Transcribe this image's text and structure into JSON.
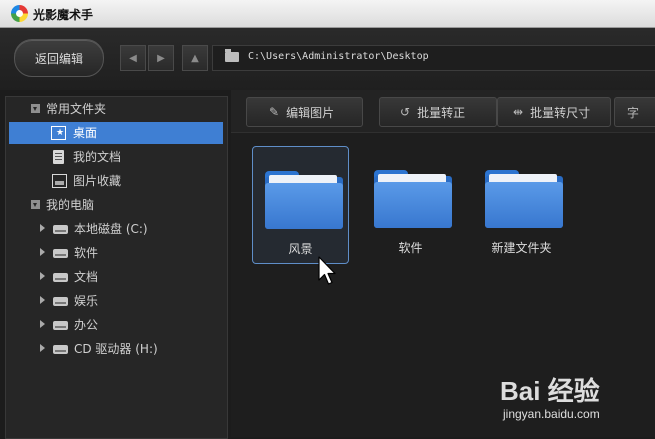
{
  "window": {
    "title": "光影魔术手",
    "logo": "app-logo-icon"
  },
  "toolbar": {
    "back_label": "返回编辑",
    "nav": {
      "back": "◀",
      "forward": "▶",
      "up": "▲"
    },
    "path": "C:\\Users\\Administrator\\Desktop"
  },
  "sidebar": {
    "groups": [
      {
        "label": "常用文件夹",
        "items": [
          "桌面",
          "我的文档",
          "图片收藏"
        ]
      },
      {
        "label": "我的电脑",
        "items": [
          "本地磁盘 (C:)",
          "软件",
          "文档",
          "娱乐",
          "办公",
          "CD 驱动器 (H:)"
        ]
      }
    ],
    "selected": "桌面"
  },
  "content_toolbar": {
    "edit_icon": "✎",
    "edit": "编辑图片",
    "rotate_icon": "↺",
    "batch_rotate": "批量转正",
    "resize_icon": "⇹",
    "batch_resize": "批量转尺寸",
    "more_icon": "字"
  },
  "folders": [
    {
      "label": "风景",
      "selected": true
    },
    {
      "label": "软件",
      "selected": false
    },
    {
      "label": "新建文件夹",
      "selected": false
    }
  ],
  "watermark": {
    "logo": "Bai 经验",
    "url": "jingyan.baidu.com"
  },
  "colors": {
    "selection": "#3f7fd3",
    "folder": "#3877cf",
    "background": "#1e1e1e"
  }
}
